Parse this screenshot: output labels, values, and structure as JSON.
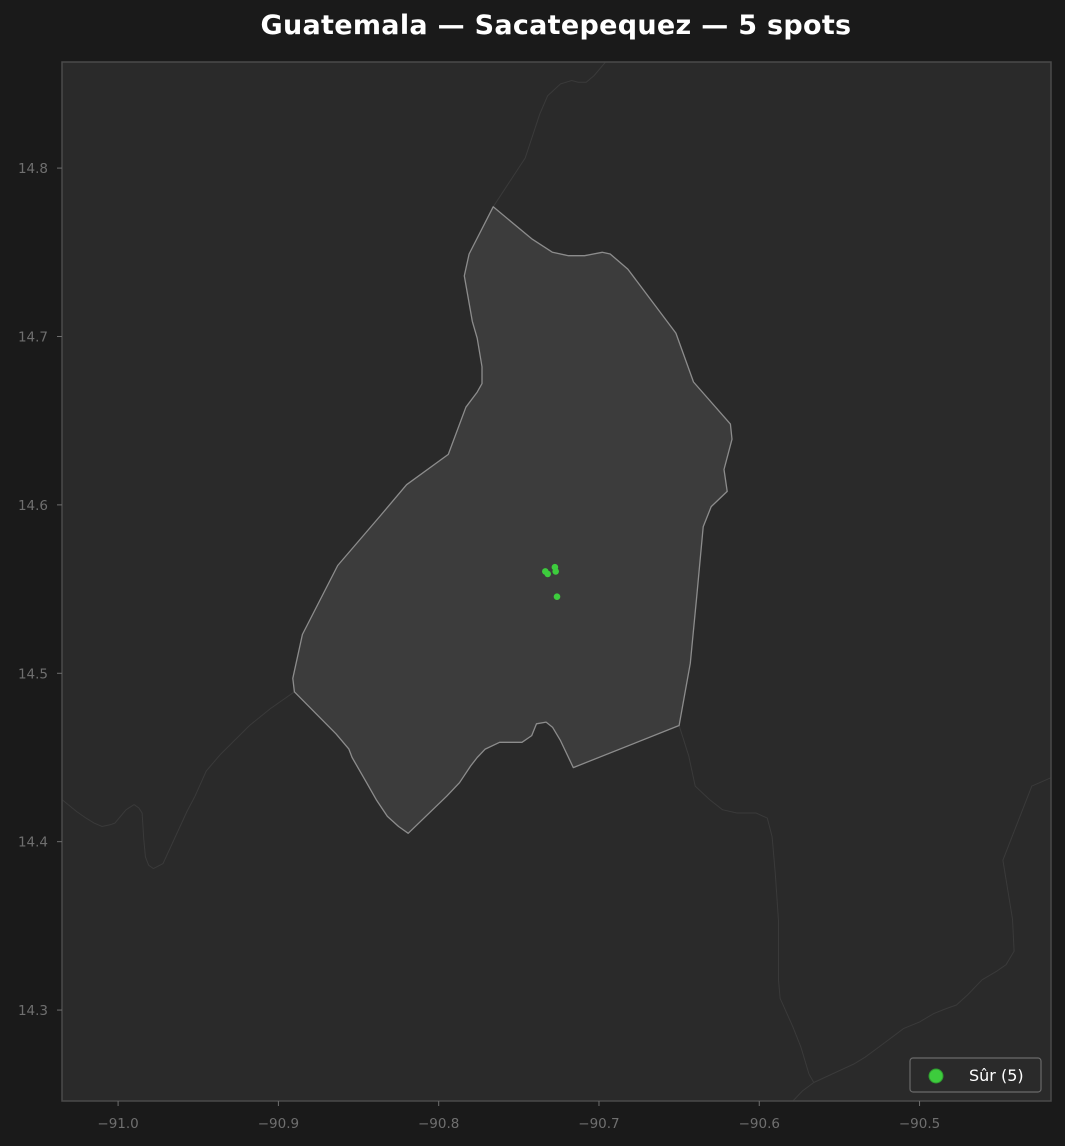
{
  "title": "Guatemala — Sacatepequez — 5 spots",
  "colors": {
    "background": "#1a1a1a",
    "plot_background": "#2a2a2a",
    "region_fill": "#3c3c3c",
    "region_edge": "#8c8c8c",
    "neighbor_edge": "#3a3a3a",
    "frame": "#4a4a4a",
    "tick": "#6f6f6f",
    "spot": "#3dcc3d"
  },
  "chart_data": {
    "type": "scatter",
    "title": "Guatemala — Sacatepequez — 5 spots",
    "xlim": [
      -91.035,
      -90.418
    ],
    "ylim": [
      14.246,
      14.863
    ],
    "x_ticks": [
      {
        "value": -91.0,
        "label": "−91.0"
      },
      {
        "value": -90.9,
        "label": "−90.9"
      },
      {
        "value": -90.8,
        "label": "−90.8"
      },
      {
        "value": -90.7,
        "label": "−90.7"
      },
      {
        "value": -90.6,
        "label": "−90.6"
      },
      {
        "value": -90.5,
        "label": "−90.5"
      }
    ],
    "y_ticks": [
      {
        "value": 14.3,
        "label": "14.3"
      },
      {
        "value": 14.4,
        "label": "14.4"
      },
      {
        "value": 14.5,
        "label": "14.5"
      },
      {
        "value": 14.6,
        "label": "14.6"
      },
      {
        "value": 14.7,
        "label": "14.7"
      },
      {
        "value": 14.8,
        "label": "14.8"
      }
    ],
    "grid": false,
    "legend_position": "bottom-right",
    "series": [
      {
        "name": "Sûr (5)",
        "color": "#3dcc3d",
        "points": [
          {
            "lon": -90.7335,
            "lat": 14.5605
          },
          {
            "lon": -90.732,
            "lat": 14.559
          },
          {
            "lon": -90.7275,
            "lat": 14.563
          },
          {
            "lon": -90.727,
            "lat": 14.5605
          },
          {
            "lon": -90.7262,
            "lat": 14.5455
          }
        ]
      }
    ],
    "region": {
      "name": "Sacatepequez",
      "boundary": [
        [
          -90.766,
          14.777
        ],
        [
          -90.742,
          14.758
        ],
        [
          -90.729,
          14.75
        ],
        [
          -90.719,
          14.748
        ],
        [
          -90.709,
          14.748
        ],
        [
          -90.698,
          14.75
        ],
        [
          -90.693,
          14.749
        ],
        [
          -90.682,
          14.74
        ],
        [
          -90.652,
          14.702
        ],
        [
          -90.641,
          14.673
        ],
        [
          -90.618,
          14.648
        ],
        [
          -90.617,
          14.639
        ],
        [
          -90.622,
          14.621
        ],
        [
          -90.62,
          14.608
        ],
        [
          -90.63,
          14.599
        ],
        [
          -90.635,
          14.587
        ],
        [
          -90.639,
          14.546
        ],
        [
          -90.643,
          14.506
        ],
        [
          -90.65,
          14.469
        ],
        [
          -90.716,
          14.444
        ],
        [
          -90.724,
          14.46
        ],
        [
          -90.729,
          14.468
        ],
        [
          -90.733,
          14.471
        ],
        [
          -90.739,
          14.47
        ],
        [
          -90.742,
          14.463
        ],
        [
          -90.748,
          14.459
        ],
        [
          -90.762,
          14.459
        ],
        [
          -90.771,
          14.455
        ],
        [
          -90.776,
          14.45
        ],
        [
          -90.78,
          14.445
        ],
        [
          -90.787,
          14.435
        ],
        [
          -90.795,
          14.427
        ],
        [
          -90.807,
          14.416
        ],
        [
          -90.819,
          14.405
        ],
        [
          -90.825,
          14.409
        ],
        [
          -90.832,
          14.415
        ],
        [
          -90.839,
          14.425
        ],
        [
          -90.845,
          14.435
        ],
        [
          -90.854,
          14.45
        ],
        [
          -90.856,
          14.455
        ],
        [
          -90.864,
          14.464
        ],
        [
          -90.89,
          14.489
        ],
        [
          -90.891,
          14.497
        ],
        [
          -90.885,
          14.523
        ],
        [
          -90.863,
          14.564
        ],
        [
          -90.836,
          14.594
        ],
        [
          -90.82,
          14.612
        ],
        [
          -90.794,
          14.63
        ],
        [
          -90.783,
          14.658
        ],
        [
          -90.776,
          14.667
        ],
        [
          -90.773,
          14.672
        ],
        [
          -90.773,
          14.682
        ],
        [
          -90.776,
          14.699
        ],
        [
          -90.779,
          14.709
        ],
        [
          -90.784,
          14.736
        ],
        [
          -90.781,
          14.749
        ]
      ]
    },
    "neighbors": [
      [
        [
          -90.766,
          14.777
        ],
        [
          -90.746,
          14.806
        ],
        [
          -90.737,
          14.832
        ],
        [
          -90.732,
          14.843
        ],
        [
          -90.724,
          14.85
        ],
        [
          -90.717,
          14.852
        ],
        [
          -90.713,
          14.851
        ],
        [
          -90.708,
          14.851
        ],
        [
          -90.703,
          14.855
        ],
        [
          -90.695,
          14.864
        ]
      ],
      [
        [
          -90.89,
          14.489
        ],
        [
          -90.905,
          14.479
        ],
        [
          -90.918,
          14.469
        ],
        [
          -90.936,
          14.452
        ],
        [
          -90.945,
          14.442
        ],
        [
          -90.952,
          14.427
        ],
        [
          -90.957,
          14.418
        ],
        [
          -90.972,
          14.387
        ],
        [
          -90.978,
          14.384
        ],
        [
          -90.981,
          14.386
        ],
        [
          -90.983,
          14.391
        ],
        [
          -90.984,
          14.402
        ],
        [
          -90.985,
          14.417
        ],
        [
          -90.987,
          14.42
        ],
        [
          -90.99,
          14.422
        ],
        [
          -90.995,
          14.419
        ],
        [
          -91.002,
          14.411
        ],
        [
          -91.005,
          14.41
        ],
        [
          -91.01,
          14.409
        ],
        [
          -91.015,
          14.411
        ],
        [
          -91.02,
          14.414
        ],
        [
          -91.026,
          14.418
        ],
        [
          -91.035,
          14.425
        ]
      ],
      [
        [
          -90.65,
          14.469
        ],
        [
          -90.644,
          14.451
        ],
        [
          -90.64,
          14.433
        ],
        [
          -90.631,
          14.425
        ],
        [
          -90.623,
          14.419
        ],
        [
          -90.614,
          14.417
        ],
        [
          -90.602,
          14.417
        ],
        [
          -90.595,
          14.414
        ],
        [
          -90.592,
          14.403
        ],
        [
          -90.59,
          14.381
        ],
        [
          -90.588,
          14.353
        ],
        [
          -90.588,
          14.318
        ],
        [
          -90.587,
          14.307
        ],
        [
          -90.579,
          14.29
        ],
        [
          -90.574,
          14.278
        ],
        [
          -90.569,
          14.262
        ],
        [
          -90.566,
          14.257
        ],
        [
          -90.573,
          14.252
        ],
        [
          -90.579,
          14.246
        ]
      ],
      [
        [
          -90.566,
          14.257
        ],
        [
          -90.541,
          14.268
        ],
        [
          -90.534,
          14.272
        ],
        [
          -90.524,
          14.279
        ],
        [
          -90.51,
          14.289
        ],
        [
          -90.5,
          14.293
        ],
        [
          -90.491,
          14.298
        ],
        [
          -90.483,
          14.301
        ],
        [
          -90.477,
          14.303
        ],
        [
          -90.47,
          14.309
        ],
        [
          -90.461,
          14.318
        ],
        [
          -90.452,
          14.323
        ],
        [
          -90.446,
          14.327
        ],
        [
          -90.441,
          14.335
        ],
        [
          -90.442,
          14.354
        ],
        [
          -90.448,
          14.389
        ],
        [
          -90.43,
          14.433
        ],
        [
          -90.418,
          14.438
        ]
      ]
    ]
  }
}
